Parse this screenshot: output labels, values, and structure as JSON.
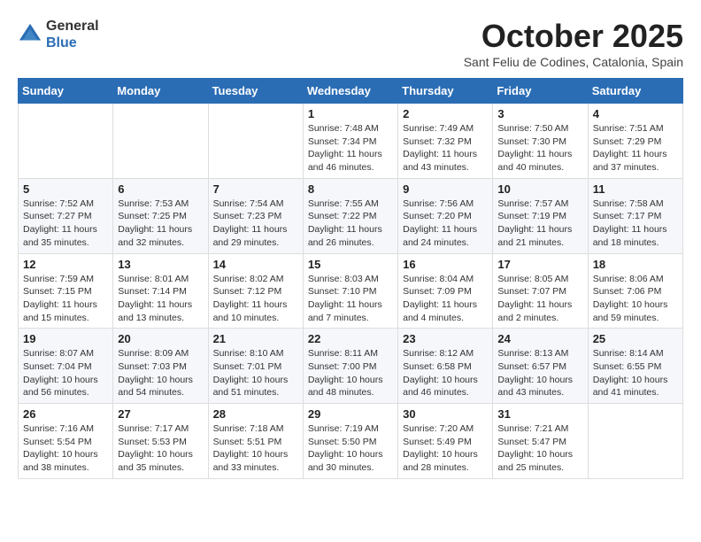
{
  "logo": {
    "general": "General",
    "blue": "Blue"
  },
  "title": "October 2025",
  "location": "Sant Feliu de Codines, Catalonia, Spain",
  "days_of_week": [
    "Sunday",
    "Monday",
    "Tuesday",
    "Wednesday",
    "Thursday",
    "Friday",
    "Saturday"
  ],
  "weeks": [
    [
      {
        "day": "",
        "info": ""
      },
      {
        "day": "",
        "info": ""
      },
      {
        "day": "",
        "info": ""
      },
      {
        "day": "1",
        "info": "Sunrise: 7:48 AM\nSunset: 7:34 PM\nDaylight: 11 hours and 46 minutes."
      },
      {
        "day": "2",
        "info": "Sunrise: 7:49 AM\nSunset: 7:32 PM\nDaylight: 11 hours and 43 minutes."
      },
      {
        "day": "3",
        "info": "Sunrise: 7:50 AM\nSunset: 7:30 PM\nDaylight: 11 hours and 40 minutes."
      },
      {
        "day": "4",
        "info": "Sunrise: 7:51 AM\nSunset: 7:29 PM\nDaylight: 11 hours and 37 minutes."
      }
    ],
    [
      {
        "day": "5",
        "info": "Sunrise: 7:52 AM\nSunset: 7:27 PM\nDaylight: 11 hours and 35 minutes."
      },
      {
        "day": "6",
        "info": "Sunrise: 7:53 AM\nSunset: 7:25 PM\nDaylight: 11 hours and 32 minutes."
      },
      {
        "day": "7",
        "info": "Sunrise: 7:54 AM\nSunset: 7:23 PM\nDaylight: 11 hours and 29 minutes."
      },
      {
        "day": "8",
        "info": "Sunrise: 7:55 AM\nSunset: 7:22 PM\nDaylight: 11 hours and 26 minutes."
      },
      {
        "day": "9",
        "info": "Sunrise: 7:56 AM\nSunset: 7:20 PM\nDaylight: 11 hours and 24 minutes."
      },
      {
        "day": "10",
        "info": "Sunrise: 7:57 AM\nSunset: 7:19 PM\nDaylight: 11 hours and 21 minutes."
      },
      {
        "day": "11",
        "info": "Sunrise: 7:58 AM\nSunset: 7:17 PM\nDaylight: 11 hours and 18 minutes."
      }
    ],
    [
      {
        "day": "12",
        "info": "Sunrise: 7:59 AM\nSunset: 7:15 PM\nDaylight: 11 hours and 15 minutes."
      },
      {
        "day": "13",
        "info": "Sunrise: 8:01 AM\nSunset: 7:14 PM\nDaylight: 11 hours and 13 minutes."
      },
      {
        "day": "14",
        "info": "Sunrise: 8:02 AM\nSunset: 7:12 PM\nDaylight: 11 hours and 10 minutes."
      },
      {
        "day": "15",
        "info": "Sunrise: 8:03 AM\nSunset: 7:10 PM\nDaylight: 11 hours and 7 minutes."
      },
      {
        "day": "16",
        "info": "Sunrise: 8:04 AM\nSunset: 7:09 PM\nDaylight: 11 hours and 4 minutes."
      },
      {
        "day": "17",
        "info": "Sunrise: 8:05 AM\nSunset: 7:07 PM\nDaylight: 11 hours and 2 minutes."
      },
      {
        "day": "18",
        "info": "Sunrise: 8:06 AM\nSunset: 7:06 PM\nDaylight: 10 hours and 59 minutes."
      }
    ],
    [
      {
        "day": "19",
        "info": "Sunrise: 8:07 AM\nSunset: 7:04 PM\nDaylight: 10 hours and 56 minutes."
      },
      {
        "day": "20",
        "info": "Sunrise: 8:09 AM\nSunset: 7:03 PM\nDaylight: 10 hours and 54 minutes."
      },
      {
        "day": "21",
        "info": "Sunrise: 8:10 AM\nSunset: 7:01 PM\nDaylight: 10 hours and 51 minutes."
      },
      {
        "day": "22",
        "info": "Sunrise: 8:11 AM\nSunset: 7:00 PM\nDaylight: 10 hours and 48 minutes."
      },
      {
        "day": "23",
        "info": "Sunrise: 8:12 AM\nSunset: 6:58 PM\nDaylight: 10 hours and 46 minutes."
      },
      {
        "day": "24",
        "info": "Sunrise: 8:13 AM\nSunset: 6:57 PM\nDaylight: 10 hours and 43 minutes."
      },
      {
        "day": "25",
        "info": "Sunrise: 8:14 AM\nSunset: 6:55 PM\nDaylight: 10 hours and 41 minutes."
      }
    ],
    [
      {
        "day": "26",
        "info": "Sunrise: 7:16 AM\nSunset: 5:54 PM\nDaylight: 10 hours and 38 minutes."
      },
      {
        "day": "27",
        "info": "Sunrise: 7:17 AM\nSunset: 5:53 PM\nDaylight: 10 hours and 35 minutes."
      },
      {
        "day": "28",
        "info": "Sunrise: 7:18 AM\nSunset: 5:51 PM\nDaylight: 10 hours and 33 minutes."
      },
      {
        "day": "29",
        "info": "Sunrise: 7:19 AM\nSunset: 5:50 PM\nDaylight: 10 hours and 30 minutes."
      },
      {
        "day": "30",
        "info": "Sunrise: 7:20 AM\nSunset: 5:49 PM\nDaylight: 10 hours and 28 minutes."
      },
      {
        "day": "31",
        "info": "Sunrise: 7:21 AM\nSunset: 5:47 PM\nDaylight: 10 hours and 25 minutes."
      },
      {
        "day": "",
        "info": ""
      }
    ]
  ]
}
